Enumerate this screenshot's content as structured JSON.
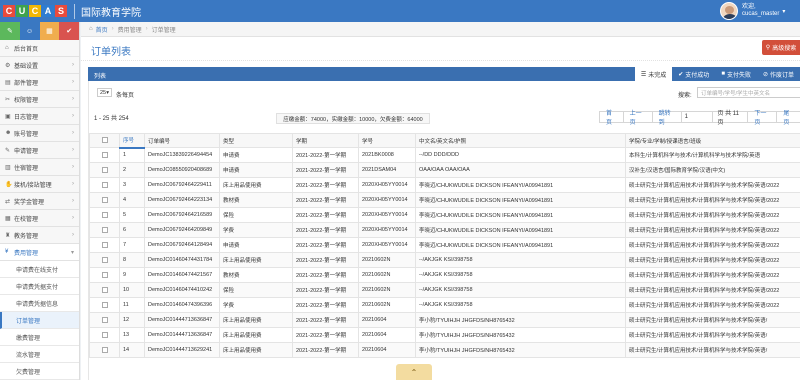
{
  "header": {
    "logo_letters": [
      "C",
      "U",
      "C",
      "A",
      "S"
    ],
    "logo_colors": [
      "#e94b3c",
      "#3fa34d",
      "#f2b705",
      "#2f7dd1",
      "#e94b3c"
    ],
    "title": "国际教育学院",
    "user_greeting": "欢迎,",
    "user_name": "cucas_master"
  },
  "breadcrumb": {
    "home": "首页",
    "parent": "费用管理",
    "current": "订单管理"
  },
  "sidebar": {
    "quick_buttons": [
      {
        "icon": "pencil-icon",
        "color": "#5cb85c",
        "glyph": "✎"
      },
      {
        "icon": "user-icon",
        "color": "#3a78c2",
        "glyph": "☺"
      },
      {
        "icon": "group-icon",
        "color": "#f0ad4e",
        "glyph": "▦"
      },
      {
        "icon": "settings-icon",
        "color": "#d9534f",
        "glyph": "✔"
      }
    ],
    "items": [
      {
        "icon": "home-icon",
        "glyph": "⌂",
        "label": "后台首页",
        "chevron": false
      },
      {
        "icon": "cog-icon",
        "glyph": "⚙",
        "label": "基础设置",
        "chevron": true
      },
      {
        "icon": "sitemap-icon",
        "glyph": "▤",
        "label": "部件管理",
        "chevron": true
      },
      {
        "icon": "wrench-icon",
        "glyph": "✂",
        "label": "权限管理",
        "chevron": true
      },
      {
        "icon": "calendar-icon",
        "glyph": "▣",
        "label": "日志管理",
        "chevron": true
      },
      {
        "icon": "user-icon",
        "glyph": "☻",
        "label": "账号管理",
        "chevron": true
      },
      {
        "icon": "pencil-icon",
        "glyph": "✎",
        "label": "申请管理",
        "chevron": true
      },
      {
        "icon": "book-icon",
        "glyph": "▥",
        "label": "住宿管理",
        "chevron": true
      },
      {
        "icon": "handshake-icon",
        "glyph": "✋",
        "label": "接机/接站管理",
        "chevron": true
      },
      {
        "icon": "exchange-icon",
        "glyph": "⇄",
        "label": "奖学金管理",
        "chevron": true
      },
      {
        "icon": "building-icon",
        "glyph": "▦",
        "label": "在校管理",
        "chevron": true
      },
      {
        "icon": "mortarboard-icon",
        "glyph": "♜",
        "label": "教务管理",
        "chevron": true
      },
      {
        "icon": "money-icon",
        "glyph": "¥",
        "label": "费用管理",
        "chevron": true,
        "active": true
      }
    ],
    "subitems": [
      {
        "label": "申请费在线支付"
      },
      {
        "label": "申请费凭据支付"
      },
      {
        "label": "申请费凭据信息"
      },
      {
        "label": "订单管理",
        "active": true
      },
      {
        "label": "缴费管理"
      },
      {
        "label": "流水管理"
      },
      {
        "label": "欠费管理"
      }
    ]
  },
  "page": {
    "title": "订单列表",
    "advanced_search": "高级搜索"
  },
  "panel": {
    "title": "列表",
    "status_tabs": [
      {
        "label": "未完成",
        "icon": "list-icon",
        "glyph": "☰",
        "active": true
      },
      {
        "label": "支付成功",
        "icon": "check-icon",
        "glyph": "✔"
      },
      {
        "label": "支付失败",
        "icon": "stop-icon",
        "glyph": "■"
      },
      {
        "label": "作废订单",
        "icon": "ban-icon",
        "glyph": "⊘"
      }
    ]
  },
  "controls": {
    "page_size": "25",
    "page_size_label": "条每页",
    "search_label": "搜索:",
    "search_placeholder": "订单编号/学号/学生中英文名"
  },
  "summary": {
    "range_text": "1 - 25 共 254",
    "totals": "应缴金额：74000，实缴金额：10000，欠费金额：64000"
  },
  "pager": {
    "first": "首页",
    "prev": "上一页",
    "goto": "跳转到",
    "current": "1",
    "total_label": "页 共 11 页",
    "next": "下一页",
    "last": "尾页"
  },
  "table": {
    "columns": [
      "",
      "序号",
      "订单编号",
      "类型",
      "学期",
      "学号",
      "中文名/英文名/护照",
      "学院/专业/学制/授课语言/班级"
    ],
    "rows": [
      [
        "1",
        "DemoJC13839226494454",
        "申请费",
        "2021-2022-第一学期",
        "2021BK0008",
        "--/DD DDD/DDD",
        "本科生/计算机科学与技术/计算机科学与技术学院/英语"
      ],
      [
        "2",
        "DemoJC08550920408689",
        "申请费",
        "2021-2022-第一学期",
        "2021DSAM04",
        "OAA/OAA OAA/OAA",
        "汉补生/汉语言/国际教育学院/汉语(中文)"
      ],
      [
        "3",
        "DemoJC06792464229411",
        "床上用品使用费",
        "2021-2022-第一学期",
        "2020XH05YY0014",
        "李晓迈/CHUKWUDILE DICKSON IFEANYI/A09941891",
        "硕士研究生/计算机应用技术/计算机科学与技术学院/英语/2022"
      ],
      [
        "4",
        "DemoJC06792464223134",
        "教材费",
        "2021-2022-第一学期",
        "2020XH05YY0014",
        "李晓迈/CHUKWUDILE DICKSON IFEANYI/A09941891",
        "硕士研究生/计算机应用技术/计算机科学与技术学院/英语/2022"
      ],
      [
        "5",
        "DemoJC06792464216589",
        "保险",
        "2021-2022-第一学期",
        "2020XH05YY0014",
        "李晓迈/CHUKWUDILE DICKSON IFEANYI/A09941891",
        "硕士研究生/计算机应用技术/计算机科学与技术学院/英语/2022"
      ],
      [
        "6",
        "DemoJC06792464209849",
        "学费",
        "2021-2022-第一学期",
        "2020XH05YY0014",
        "李晓迈/CHUKWUDILE DICKSON IFEANYI/A09941891",
        "硕士研究生/计算机应用技术/计算机科学与技术学院/英语/2022"
      ],
      [
        "7",
        "DemoJC06792464128494",
        "申请费",
        "2021-2022-第一学期",
        "2020XH05YY0014",
        "李晓迈/CHUKWUDILE DICKSON IFEANYI/A09941891",
        "硕士研究生/计算机应用技术/计算机科学与技术学院/英语/2022"
      ],
      [
        "8",
        "DemoJC01460474431784",
        "床上用品使用费",
        "2021-2022-第一学期",
        "20210602N",
        "--/AKJGK KSI/398758",
        "硕士研究生/计算机应用技术/计算机科学与技术学院/英语/2022"
      ],
      [
        "9",
        "DemoJC01460474421567",
        "教材费",
        "2021-2022-第一学期",
        "20210602N",
        "--/AKJGK KSI/398758",
        "硕士研究生/计算机应用技术/计算机科学与技术学院/英语/2022"
      ],
      [
        "10",
        "DemoJC01460474410242",
        "保险",
        "2021-2022-第一学期",
        "20210602N",
        "--/AKJGK KSI/398758",
        "硕士研究生/计算机应用技术/计算机科学与技术学院/英语/2022"
      ],
      [
        "11",
        "DemoJC01460474396396",
        "学费",
        "2021-2022-第一学期",
        "20210602N",
        "--/AKJGK KSI/398758",
        "硕士研究生/计算机应用技术/计算机科学与技术学院/英语/2022"
      ],
      [
        "12",
        "DemoJC01444713636847",
        "床上用品使用费",
        "2021-2022-第一学期",
        "20210604",
        "李小豹/TYUIHJH JHGFDS/NH8765432",
        "硕士研究生/计算机应用技术/计算机科学与技术学院/英语/"
      ],
      [
        "13",
        "DemoJC01444713636847",
        "床上用品使用费",
        "2021-2022-第一学期",
        "20210604",
        "李小豹/TYUIHJH JHGFDS/NH8765432",
        "硕士研究生/计算机应用技术/计算机科学与技术学院/英语/"
      ],
      [
        "14",
        "DemoJC01444713629241",
        "床上用品使用费",
        "2021-2022-第一学期",
        "20210604",
        "李小豹/TYUIHJH JHGFDS/NH8765432",
        "硕士研究生/计算机应用技术/计算机科学与技术学院/英语/"
      ]
    ]
  },
  "scroll_top_glyph": "⌃"
}
